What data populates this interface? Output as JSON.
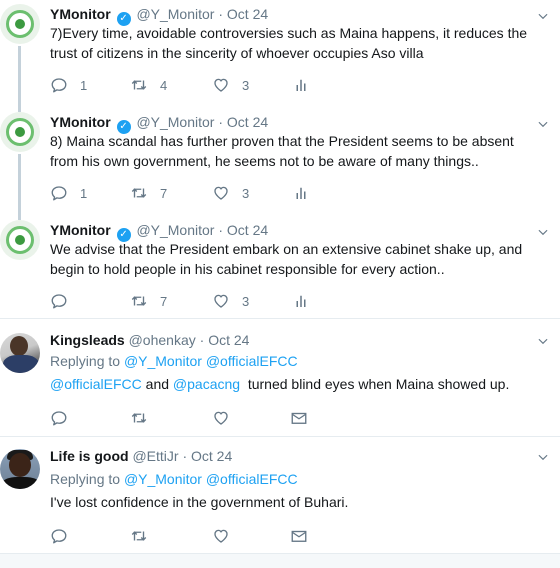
{
  "tweets": [
    {
      "name": "YMonitor",
      "handle": "@Y_Monitor",
      "sep": "·",
      "time": "Oct 24",
      "text": "7)Every time, avoidable controversies such as Maina happens, it reduces the trust of citizens in the sincerity of whoever occupies Aso villa",
      "reply_count": "1",
      "retweet_count": "4",
      "like_count": "3"
    },
    {
      "name": "YMonitor",
      "handle": "@Y_Monitor",
      "sep": "·",
      "time": "Oct 24",
      "text": "8) Maina scandal has further proven that the President seems to be absent from his own government, he seems not to be aware of many things..",
      "reply_count": "1",
      "retweet_count": "7",
      "like_count": "3"
    },
    {
      "name": "YMonitor",
      "handle": "@Y_Monitor",
      "sep": "·",
      "time": "Oct 24",
      "text": "We advise that the President embark on an extensive cabinet shake up, and begin to hold people in his cabinet responsible for every action..",
      "reply_count": "",
      "retweet_count": "7",
      "like_count": "3"
    },
    {
      "name": "Kingsleads",
      "handle": "@ohenkay",
      "sep": "·",
      "time": "Oct 24",
      "replying_label": "Replying to",
      "replying_mentions": "@Y_Monitor @officialEFCC",
      "mention1": "@officialEFCC",
      "and_text": " and ",
      "mention2": "@pacacng",
      "text_rest": "  turned blind eyes when Maina showed up."
    },
    {
      "name": "Life is good",
      "handle": "@EttiJr",
      "sep": "·",
      "time": "Oct 24",
      "replying_label": "Replying to",
      "replying_mentions": "@Y_Monitor @officialEFCC",
      "text": "I've lost confidence in the government of Buhari."
    }
  ],
  "icons": {
    "reply": "reply-icon",
    "retweet": "retweet-icon",
    "like": "heart-icon",
    "analytics": "analytics-icon",
    "dm": "envelope-icon",
    "more": "chevron-down-icon",
    "verified": "verified-badge-icon"
  },
  "colors": {
    "link": "#1da1f2",
    "secondary_text": "#657786",
    "primary_text": "#14171a",
    "thread_line": "#c4d1da",
    "divider": "#e6ecf0"
  }
}
